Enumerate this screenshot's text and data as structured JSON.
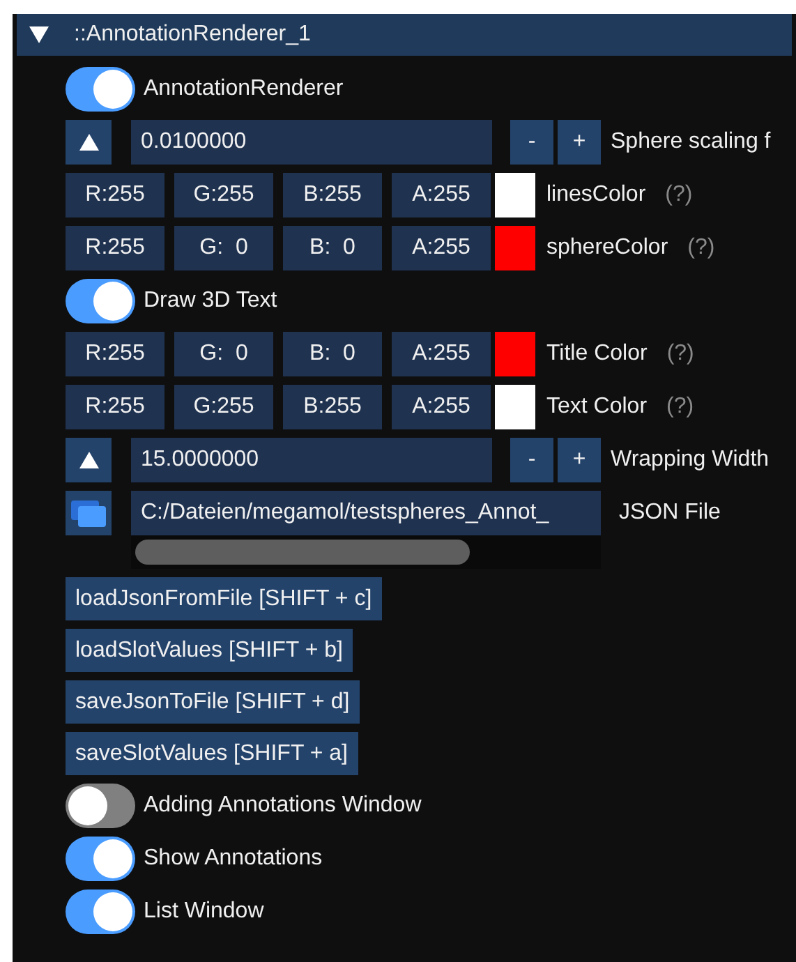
{
  "header": {
    "title": "::AnnotationRenderer_1",
    "expanded": true
  },
  "items": [
    {
      "kind": "toggle",
      "label": "AnnotationRenderer",
      "on": true
    },
    {
      "kind": "scalar",
      "label": "Sphere scaling f",
      "input": "0.0100000",
      "minus": "-",
      "plus": "+"
    },
    {
      "kind": "color",
      "channels": [
        "R:255",
        "G:255",
        "B:255",
        "A:255"
      ],
      "color": "#ffffff",
      "label": "linesColor",
      "help": "(?)"
    },
    {
      "kind": "color",
      "channels": [
        "R:255",
        "G:  0",
        "B:  0",
        "A:255"
      ],
      "color": "#ff0000",
      "label": "sphereColor",
      "help": "(?)"
    },
    {
      "kind": "toggle",
      "label": "Draw 3D Text",
      "on": true
    },
    {
      "kind": "color",
      "channels": [
        "R:255",
        "G:  0",
        "B:  0",
        "A:255"
      ],
      "color": "#ff0000",
      "label": "Title Color",
      "help": "(?)"
    },
    {
      "kind": "color",
      "channels": [
        "R:255",
        "G:255",
        "B:255",
        "A:255"
      ],
      "color": "#ffffff",
      "label": "Text Color",
      "help": "(?)"
    },
    {
      "kind": "scalar",
      "label": "Wrapping Width",
      "input": "15.0000000",
      "minus": "-",
      "plus": "+"
    },
    {
      "kind": "file",
      "value": "C:/Dateien/megamol/testspheres_Annot_",
      "label": "JSON File"
    },
    {
      "kind": "button",
      "label": "loadJsonFromFile [SHIFT + c]"
    },
    {
      "kind": "button",
      "label": "loadSlotValues [SHIFT + b]"
    },
    {
      "kind": "button",
      "label": "saveJsonToFile [SHIFT + d]"
    },
    {
      "kind": "button",
      "label": "saveSlotValues [SHIFT + a]"
    },
    {
      "kind": "toggle",
      "label": "Adding Annotations Window",
      "on": false
    },
    {
      "kind": "toggle",
      "label": "Show Annotations",
      "on": true
    },
    {
      "kind": "toggle",
      "label": "List Window",
      "on": true
    }
  ]
}
